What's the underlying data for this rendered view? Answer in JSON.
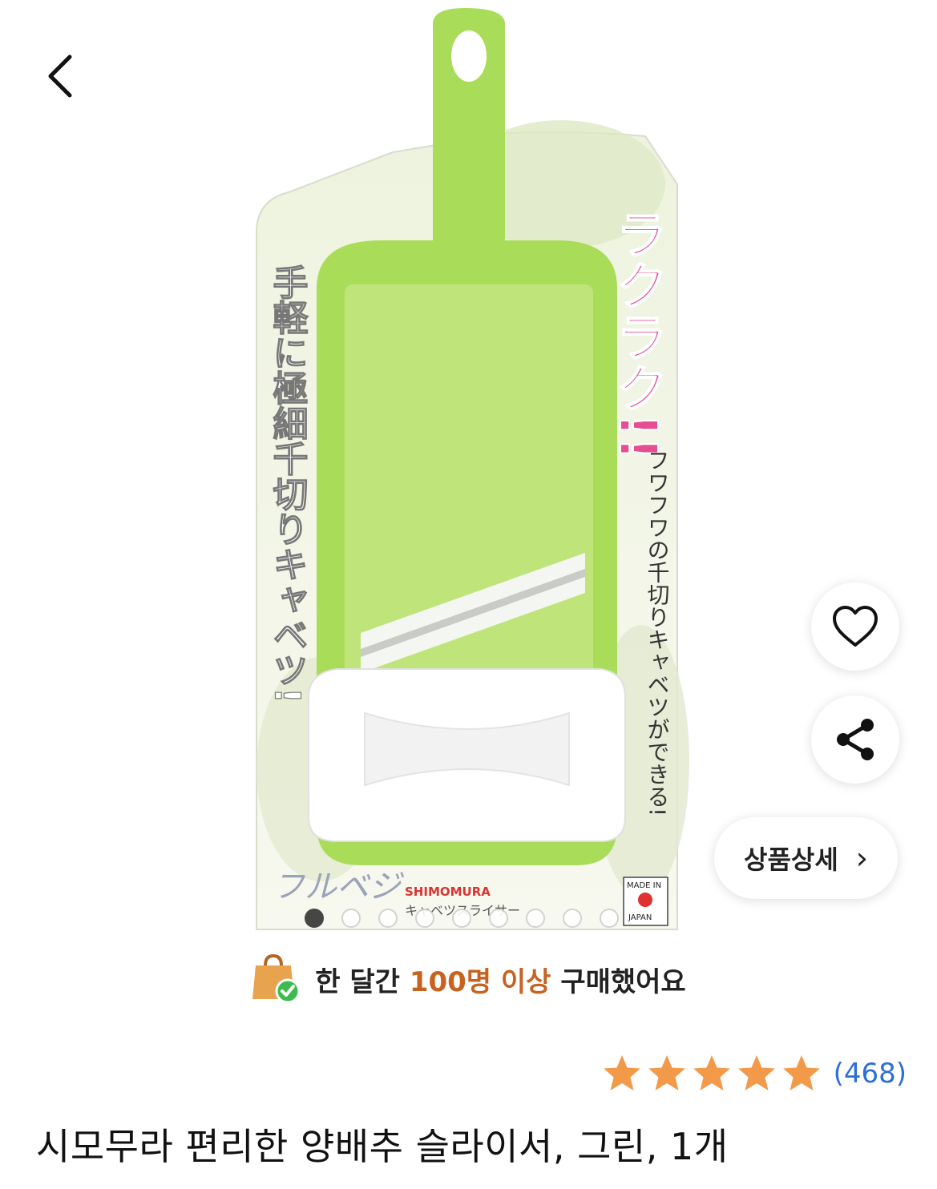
{
  "nav": {
    "back_icon": "chevron-left-icon"
  },
  "product_image": {
    "brand": "SHIMOMURA",
    "catch_top": "ラクラク!!",
    "headline": "手軽に極細千切りキャベツ!",
    "subline": "フワフワの千切りキャベツができる!",
    "logo": "フルベジ",
    "product_kind": "キャベツスライサー",
    "made_in": "MADE IN",
    "made_in_country": "JAPAN",
    "slide_count": 9,
    "active_slide": 0
  },
  "actions": {
    "wishlist_icon": "heart-icon",
    "share_icon": "share-icon",
    "detail_label": "상품상세",
    "detail_chevron": "›"
  },
  "purchase_stats": {
    "icon": "shopping-bag-check-icon",
    "prefix": "한 달간",
    "highlight": "100명 이상",
    "suffix": "구매했어요"
  },
  "rating": {
    "stars": 5,
    "count": "(468)",
    "star_color": "#f39a4a"
  },
  "product": {
    "title": "시모무라 편리한 양배추 슬라이서, 그린, 1개"
  },
  "colors": {
    "accent": "#c7621f",
    "link": "#2c6fd6",
    "slicer_green": "#a9dc58"
  }
}
